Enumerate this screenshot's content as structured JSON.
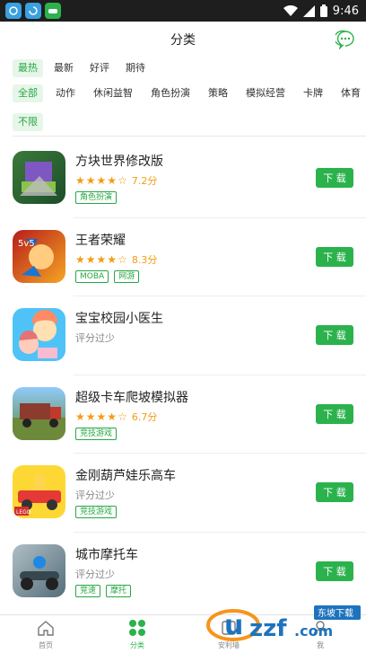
{
  "status": {
    "time": "9:46",
    "icons": [
      "sync-app-icon",
      "refresh-app-icon",
      "gamepad-app-icon",
      "wifi-icon",
      "signal-icon",
      "battery-icon"
    ]
  },
  "header": {
    "title": "分类",
    "message_icon": "chat-bubble-icon"
  },
  "filters": {
    "sort": [
      {
        "label": "最热",
        "active": true
      },
      {
        "label": "最新",
        "active": false
      },
      {
        "label": "好评",
        "active": false
      },
      {
        "label": "期待",
        "active": false
      }
    ],
    "genre": [
      {
        "label": "全部",
        "active": true
      },
      {
        "label": "动作",
        "active": false
      },
      {
        "label": "休闲益智",
        "active": false
      },
      {
        "label": "角色扮演",
        "active": false
      },
      {
        "label": "策略",
        "active": false
      },
      {
        "label": "模拟经营",
        "active": false
      },
      {
        "label": "卡牌",
        "active": false
      },
      {
        "label": "体育",
        "active": false
      }
    ],
    "size": [
      {
        "label": "不限",
        "active": true
      }
    ]
  },
  "apps": [
    {
      "name": "方块世界修改版",
      "stars": 4,
      "score": "7.2分",
      "tags": [
        "角色扮演"
      ],
      "download": "下 载",
      "icon": "block-world-icon"
    },
    {
      "name": "王者荣耀",
      "stars": 4,
      "score": "8.3分",
      "tags": [
        "MOBA",
        "网游"
      ],
      "download": "下 载",
      "icon": "honor-of-kings-icon"
    },
    {
      "name": "宝宝校园小医生",
      "rating_text": "评分过少",
      "tags": [],
      "download": "下 载",
      "icon": "baby-doctor-icon"
    },
    {
      "name": "超级卡车爬坡模拟器",
      "stars": 4,
      "score": "6.7分",
      "tags": [
        "竞技游戏"
      ],
      "download": "下 载",
      "icon": "truck-icon"
    },
    {
      "name": "金刚葫芦娃乐高车",
      "rating_text": "评分过少",
      "tags": [
        "竞技游戏"
      ],
      "download": "下 载",
      "icon": "lego-car-icon"
    },
    {
      "name": "城市摩托车",
      "rating_text": "评分过少",
      "tags": [
        "竞速",
        "摩托"
      ],
      "download": "下 载",
      "icon": "motorbike-icon"
    }
  ],
  "nav": [
    {
      "label": "首页",
      "icon": "home-icon",
      "active": false
    },
    {
      "label": "分类",
      "icon": "category-icon",
      "active": true
    },
    {
      "label": "安利墙",
      "icon": "wall-icon",
      "active": false
    },
    {
      "label": "我",
      "icon": "profile-icon",
      "active": false
    }
  ],
  "watermark": {
    "text": "uzzf.com",
    "badge": "东坡下载"
  },
  "colors": {
    "accent": "#2bb24c",
    "star": "#f39c12",
    "statusbar": "#1e1e1e"
  }
}
